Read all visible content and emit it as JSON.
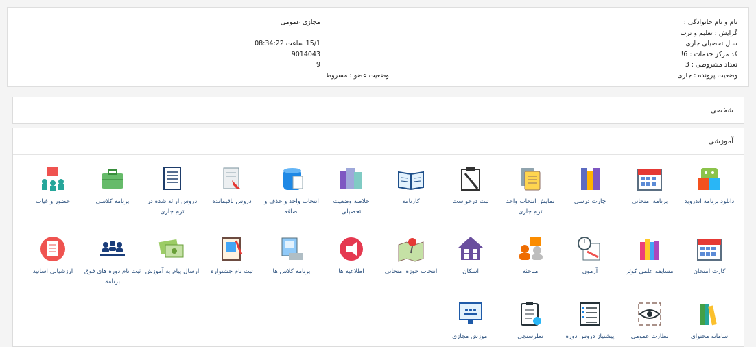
{
  "student_info": {
    "right_lines": [
      "نام و نام خانوادگی :",
      "گرایش : تعلیم و ترب",
      "سال تحصیلی جاری",
      "کد مرکز خدمات : 6!",
      "تعداد مشروطی : 3",
      "وضعیت پرونده : جاری"
    ],
    "mid_title": "مجازی عمومی",
    "mid_datetime": "15/1 ساعت 08:34:22",
    "mid_number": "9014043",
    "mid_digit": "9",
    "mid_status": "وضعیت عضو : مسروط"
  },
  "panels": {
    "personal_title": "شخصی",
    "education_title": "آموزشی"
  },
  "tiles": [
    {
      "label": "دانلود برنامه اندروید",
      "icon": "android-icon"
    },
    {
      "label": "برنامه امتحانی",
      "icon": "calendar-icon"
    },
    {
      "label": "چارت درسی",
      "icon": "books-icon"
    },
    {
      "label": "نمایش انتخاب واحد ترم جاری",
      "icon": "documents-icon"
    },
    {
      "label": "ثبت درخواست",
      "icon": "clipboard-pen-icon"
    },
    {
      "label": "کارنامه",
      "icon": "open-book-icon"
    },
    {
      "label": "خلاصه وضعیت تحصیلی",
      "icon": "folders-icon"
    },
    {
      "label": "انتخاب واحد و حذف و اضافه",
      "icon": "database-doc-icon"
    },
    {
      "label": "دروس باقیمانده",
      "icon": "document-arrow-icon"
    },
    {
      "label": "دروس ارائه شده در ترم جاری",
      "icon": "document-list-icon"
    },
    {
      "label": "برنامه کلاسی",
      "icon": "briefcase-icon"
    },
    {
      "label": "حضور و غیاب",
      "icon": "classroom-icon"
    },
    {
      "label": "کارت امتحان",
      "icon": "calendar-icon"
    },
    {
      "label": "مسابقه علمي کوئز",
      "icon": "books-stack-icon"
    },
    {
      "label": "آزمون",
      "icon": "exam-clock-icon"
    },
    {
      "label": "مباحثه",
      "icon": "discussion-icon"
    },
    {
      "label": "اسکان",
      "icon": "house-icon"
    },
    {
      "label": "انتخاب حوزه امتحانی",
      "icon": "map-pin-icon"
    },
    {
      "label": "اطلاعیه ها",
      "icon": "megaphone-icon"
    },
    {
      "label": "برنامه کلاس ها",
      "icon": "monitor-icon"
    },
    {
      "label": "ثبت نام جشنواره",
      "icon": "festival-icon"
    },
    {
      "label": "ارسال پیام به آموزش",
      "icon": "money-message-icon"
    },
    {
      "label": "ثبت نام دوره های فوق برنامه",
      "icon": "group-icon"
    },
    {
      "label": "ارزشیابی اساتید",
      "icon": "evaluation-icon"
    },
    {
      "label": "سامانه محتوای",
      "icon": "books-shelf-icon"
    },
    {
      "label": "نظارت عمومی",
      "icon": "eye-icon"
    },
    {
      "label": "پیشنیاز دروس دوره",
      "icon": "checklist-icon"
    },
    {
      "label": "نظرسنجی",
      "icon": "survey-icon"
    },
    {
      "label": "آموزش مجازی",
      "icon": "virtual-class-icon"
    }
  ],
  "colors": {
    "link": "#2a4f7c",
    "panel_border": "#dcdcdc",
    "page_bg": "#f4f4f4"
  }
}
